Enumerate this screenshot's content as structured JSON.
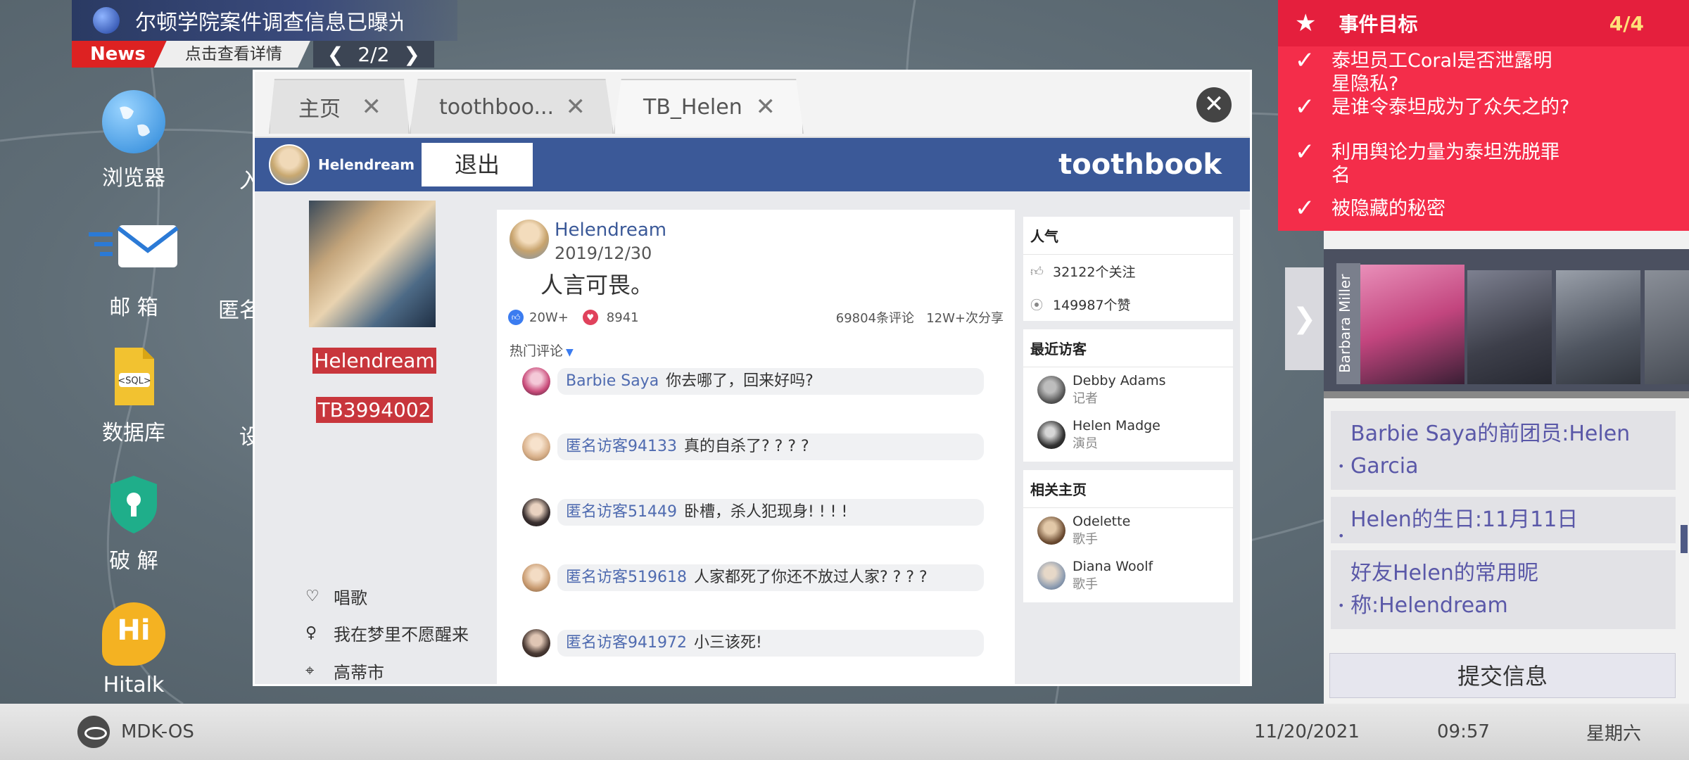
{
  "news": {
    "headline": "尔顿学院案件调查信息已曝光",
    "tag": "News",
    "detail_label": "点击查看详情",
    "page": "2/2"
  },
  "desktop": {
    "icons": [
      {
        "label": "浏览器",
        "icon": "globe-icon"
      },
      {
        "label": "邮 箱",
        "icon": "mail-icon"
      },
      {
        "label": "数据库",
        "icon": "sql-file-icon"
      },
      {
        "label": "破 解",
        "icon": "shield-key-icon"
      },
      {
        "label": "Hitalk",
        "icon": "hitalk-icon"
      }
    ],
    "partial_labels": [
      "入",
      "匿名",
      "设"
    ]
  },
  "window": {
    "tabs": [
      {
        "label": "主页"
      },
      {
        "label": "toothboo..."
      },
      {
        "label": "TB_Helen"
      }
    ],
    "header": {
      "username": "Helendream",
      "logout_label": "退出",
      "brand": "toothbook"
    },
    "profile": {
      "name": "Helendream",
      "id": "TB3994002",
      "info": [
        {
          "icon": "heart-outline-icon",
          "text": "唱歌"
        },
        {
          "icon": "tie-icon",
          "text": "我在梦里不愿醒来"
        },
        {
          "icon": "location-icon",
          "text": "高蒂市"
        }
      ]
    },
    "post": {
      "author": "Helendream",
      "date": "2019/12/30",
      "text": "人言可畏。",
      "likes": "20W+",
      "hearts": "8941",
      "comments_count": "69804条评论",
      "shares": "12W+次分享",
      "hot_label": "热门评论",
      "comments": [
        {
          "user": "Barbie Saya",
          "text": "你去哪了，回来好吗?",
          "color": "#c94b7a"
        },
        {
          "user": "匿名访客94133",
          "text": "真的自杀了? ? ? ?",
          "color": "#d8b08a"
        },
        {
          "user": "匿名访客51449",
          "text": "卧槽，杀人犯现身! ! ! !",
          "color": "#3a3030"
        },
        {
          "user": "匿名访客519618",
          "text": "人家都死了你还不放过人家? ? ? ?",
          "color": "#c99c72"
        },
        {
          "user": "匿名访客941972",
          "text": "小三该死!",
          "color": "#4a3a34"
        }
      ]
    },
    "side": {
      "popularity": {
        "title": "人气",
        "followers": "32122个关注",
        "likes": "149987个赞"
      },
      "visitors": {
        "title": "最近访客",
        "items": [
          {
            "name": "Debby Adams",
            "role": "记者"
          },
          {
            "name": "Helen Madge",
            "role": "演员"
          }
        ]
      },
      "related": {
        "title": "相关主页",
        "items": [
          {
            "name": "Odelette",
            "role": "歌手"
          },
          {
            "name": "Diana Woolf",
            "role": "歌手"
          }
        ]
      }
    }
  },
  "goals": {
    "title": "事件目标",
    "count": "4/4",
    "items": [
      "泰坦员工Coral是否泄露明星隐私?",
      "是谁令泰坦成为了众矢之的?",
      "利用舆论力量为泰坦洗脱罪名",
      "被隐藏的秘密"
    ]
  },
  "evidence": {
    "gallery_label": "Barbara Miller",
    "items": [
      "Barbie Saya的前团员:Helen Garcia",
      "Helen的生日:11月11日",
      "好友Helen的常用昵称:Helendream"
    ],
    "submit_label": "提交信息"
  },
  "taskbar": {
    "os_name": "MDK-OS",
    "date": "11/20/2021",
    "time": "09:57",
    "weekday": "星期六"
  }
}
